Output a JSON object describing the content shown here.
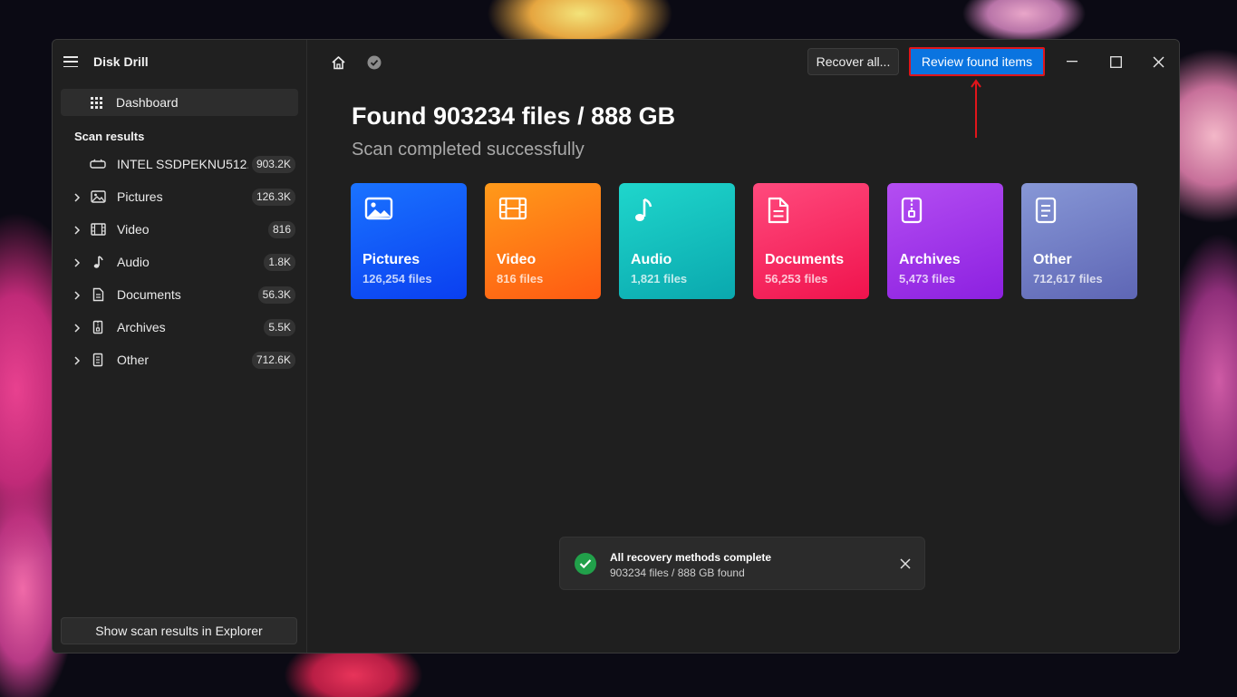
{
  "app": {
    "title": "Disk Drill"
  },
  "sidebar": {
    "dashboard_label": "Dashboard",
    "section_label": "Scan results",
    "drive": {
      "label": "INTEL SSDPEKNU512...",
      "count": "903.2K"
    },
    "items": [
      {
        "label": "Pictures",
        "count": "126.3K",
        "icon": "image-icon"
      },
      {
        "label": "Video",
        "count": "816",
        "icon": "film-icon"
      },
      {
        "label": "Audio",
        "count": "1.8K",
        "icon": "music-note-icon"
      },
      {
        "label": "Documents",
        "count": "56.3K",
        "icon": "document-icon"
      },
      {
        "label": "Archives",
        "count": "5.5K",
        "icon": "archive-icon"
      },
      {
        "label": "Other",
        "count": "712.6K",
        "icon": "file-icon"
      }
    ],
    "explorer_button": "Show scan results in Explorer"
  },
  "toolbar": {
    "recover_all": "Recover all...",
    "review": "Review found items"
  },
  "main": {
    "headline": "Found 903234 files / 888 GB",
    "subline": "Scan completed successfully",
    "cards": [
      {
        "name": "Pictures",
        "count": "126,254 files",
        "color_from": "#1a73ff",
        "color_to": "#0a3ff0"
      },
      {
        "name": "Video",
        "count": "816 files",
        "color_from": "#ff9a1a",
        "color_to": "#ff5a12"
      },
      {
        "name": "Audio",
        "count": "1,821 files",
        "color_from": "#1fd6cc",
        "color_to": "#0aa8ae"
      },
      {
        "name": "Documents",
        "count": "56,253 files",
        "color_from": "#ff4a7d",
        "color_to": "#f0134d"
      },
      {
        "name": "Archives",
        "count": "5,473 files",
        "color_from": "#b44ef2",
        "color_to": "#8c20e0"
      },
      {
        "name": "Other",
        "count": "712,617 files",
        "color_from": "#8797d6",
        "color_to": "#5e66b5"
      }
    ]
  },
  "toast": {
    "title": "All recovery methods complete",
    "detail": "903234 files / 888 GB found"
  },
  "colors": {
    "accent": "#0a74e0",
    "highlight": "#e0151b",
    "success": "#21a04a"
  }
}
